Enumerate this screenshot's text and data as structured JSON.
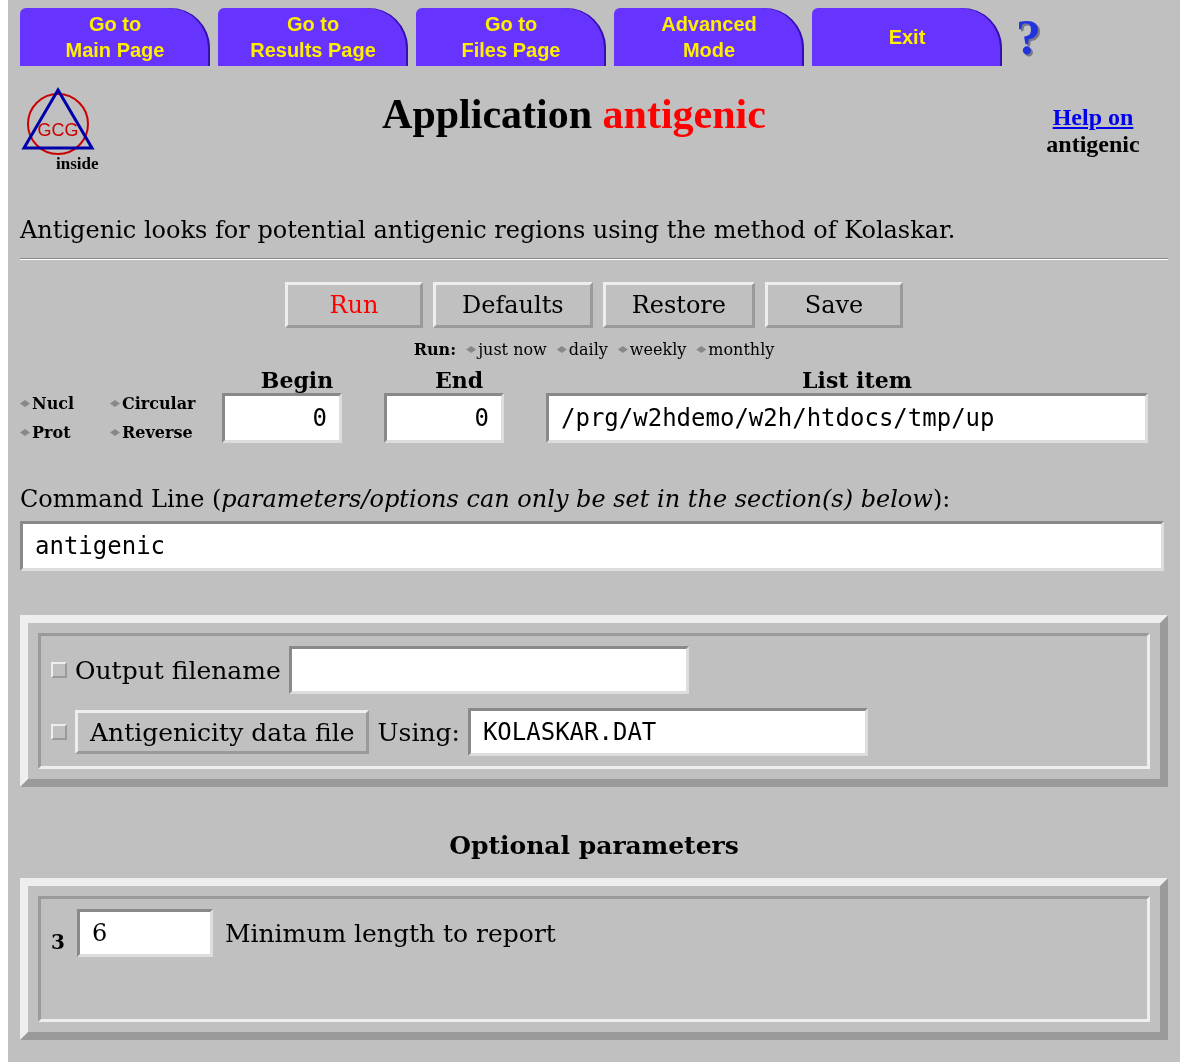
{
  "nav_tabs": [
    {
      "label": "Go to\nMain Page"
    },
    {
      "label": "Go to\nResults Page"
    },
    {
      "label": "Go to\nFiles Page"
    },
    {
      "label": "Advanced\nMode"
    },
    {
      "label": "Exit"
    }
  ],
  "help_mark": "?",
  "logo": {
    "letters": "GCG",
    "caption": "inside"
  },
  "title": {
    "prefix": "Application",
    "name": "antigenic"
  },
  "help_link": {
    "link": "Help on",
    "name": "antigenic"
  },
  "description": "Antigenic looks for potential antigenic regions using the method of Kolaskar.",
  "action_buttons": [
    {
      "label": "Run",
      "kind": "primary"
    },
    {
      "label": "Defaults",
      "kind": "normal"
    },
    {
      "label": "Restore",
      "kind": "normal"
    },
    {
      "label": "Save",
      "kind": "normal"
    }
  ],
  "run_schedule": {
    "label": "Run:",
    "options": [
      {
        "label": "just now",
        "selected": false
      },
      {
        "label": "daily",
        "selected": false
      },
      {
        "label": "weekly",
        "selected": false
      },
      {
        "label": "monthly",
        "selected": false
      }
    ]
  },
  "sequence_options": [
    {
      "label": "Nucl",
      "selected": false
    },
    {
      "label": "Circular",
      "selected": false
    },
    {
      "label": "Prot",
      "selected": false
    },
    {
      "label": "Reverse",
      "selected": false
    }
  ],
  "begin": {
    "label": "Begin",
    "value": "0"
  },
  "end": {
    "label": "End",
    "value": "0"
  },
  "list_item": {
    "label": "List item",
    "value": "/prg/w2hdemo/w2h/htdocs/tmp/up"
  },
  "command_line": {
    "label": "Command Line (*parameters/options can only be set in the section(s) below*):",
    "value": "antigenic"
  },
  "section_1": [
    {
      "kind": "field",
      "checked": false,
      "label": "Output filename"
    },
    {
      "kind": "file",
      "checked": false,
      "button": "Antigenicity data file",
      "label": "Using:",
      "value": "KOLASKAR.DAT"
    }
  ],
  "optional_heading": "Optional parameters",
  "section_2": [
    {
      "number": "3",
      "value": "6",
      "label": "Minimum length to report"
    }
  ]
}
